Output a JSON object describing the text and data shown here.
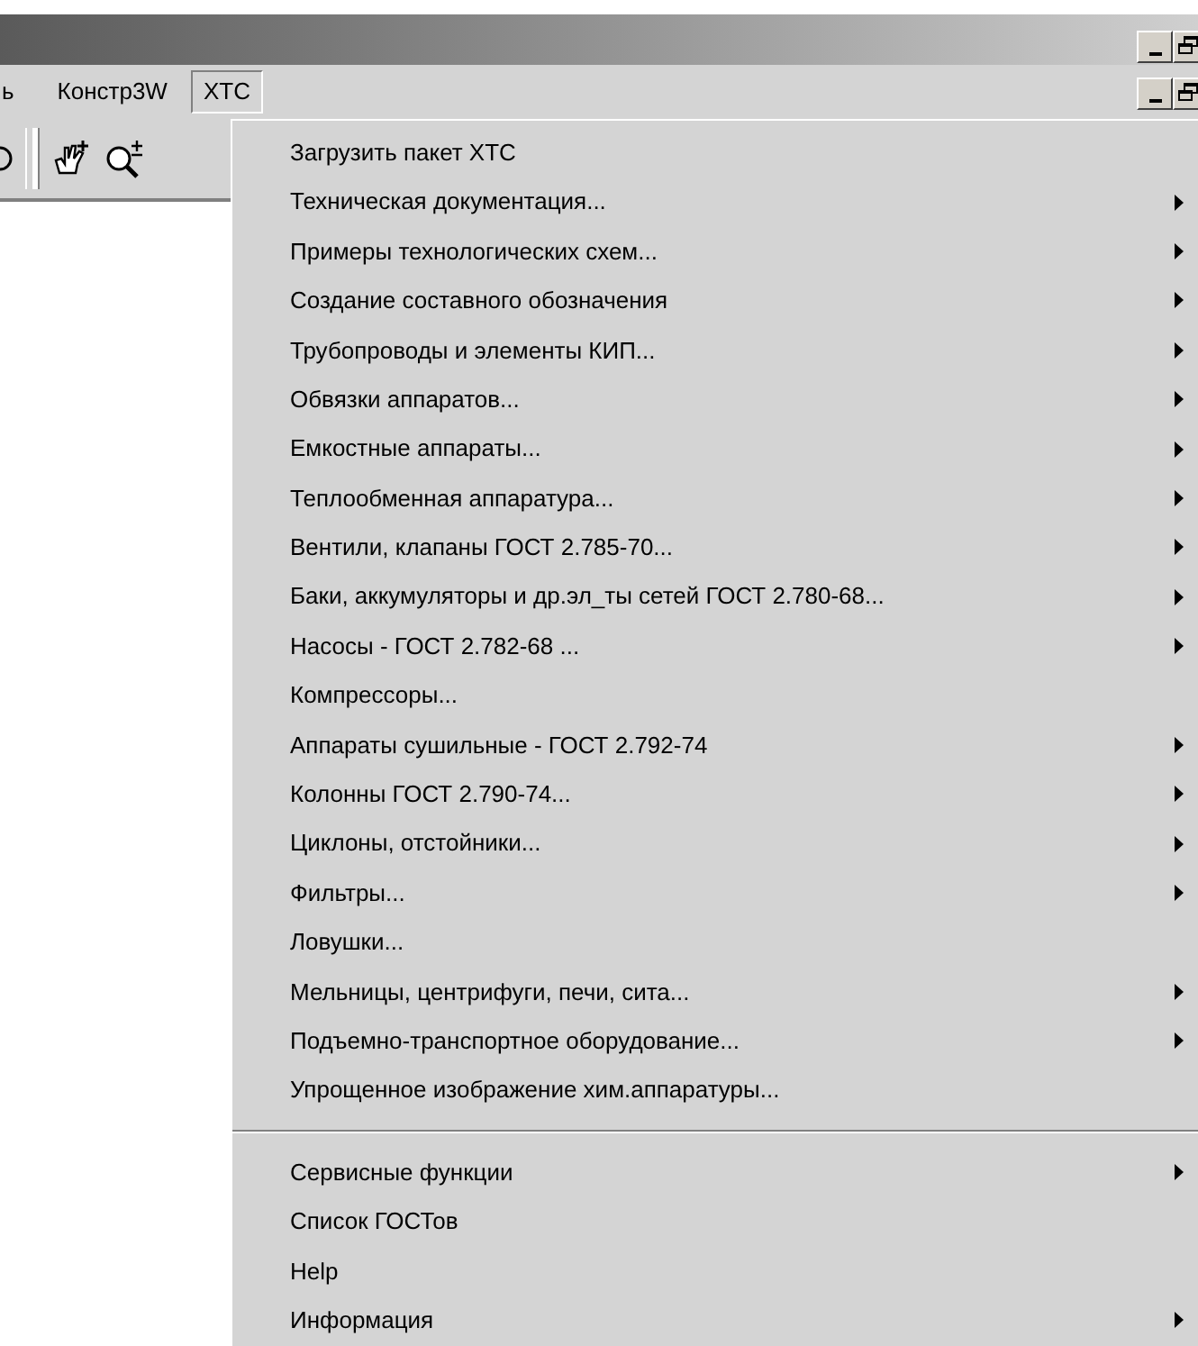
{
  "menubar": [
    {
      "label": "ь",
      "selected": false
    },
    {
      "label": "Констр3W",
      "selected": false
    },
    {
      "label": "XTC",
      "selected": true
    }
  ],
  "menu": {
    "items": [
      {
        "kind": "item",
        "label": "Загрузить пакет XTC",
        "submenu": false
      },
      {
        "kind": "item",
        "label": "Техническая документация...",
        "submenu": true
      },
      {
        "kind": "item",
        "label": "Примеры технологических схем...",
        "submenu": true
      },
      {
        "kind": "item",
        "label": "Создание составного обозначения",
        "submenu": true
      },
      {
        "kind": "item",
        "label": "Трубопроводы и элементы КИП...",
        "submenu": true
      },
      {
        "kind": "item",
        "label": "Обвязки аппаратов...",
        "submenu": true
      },
      {
        "kind": "item",
        "label": "Емкостные аппараты...",
        "submenu": true
      },
      {
        "kind": "item",
        "label": "Теплообменная аппаратура...",
        "submenu": true
      },
      {
        "kind": "item",
        "label": "Вентили, клапаны  ГОСТ 2.785-70...",
        "submenu": true
      },
      {
        "kind": "item",
        "label": "Баки, аккумуляторы и др.эл_ты сетей ГОСТ 2.780-68...",
        "submenu": true
      },
      {
        "kind": "item",
        "label": "Насосы - ГОСТ 2.782-68 ...",
        "submenu": true
      },
      {
        "kind": "item",
        "label": "Компрессоры...",
        "submenu": false
      },
      {
        "kind": "item",
        "label": "Аппараты сушильные - ГОСТ 2.792-74",
        "submenu": true
      },
      {
        "kind": "item",
        "label": "Колонны ГОСТ 2.790-74...",
        "submenu": true
      },
      {
        "kind": "item",
        "label": "Циклоны, отстойники...",
        "submenu": true
      },
      {
        "kind": "item",
        "label": "Фильтры...",
        "submenu": true
      },
      {
        "kind": "item",
        "label": "Ловушки...",
        "submenu": false
      },
      {
        "kind": "item",
        "label": "Мельницы, центрифуги, печи, сита...",
        "submenu": true
      },
      {
        "kind": "item",
        "label": "Подъемно-транспортное оборудование...",
        "submenu": true
      },
      {
        "kind": "item",
        "label": "Упрощенное изображение хим.аппаратуры...",
        "submenu": false
      },
      {
        "kind": "separator"
      },
      {
        "kind": "item",
        "label": "Сервисные функции",
        "submenu": true
      },
      {
        "kind": "item",
        "label": "Список ГОСТов",
        "submenu": false
      },
      {
        "kind": "item",
        "label": "Help",
        "submenu": false
      },
      {
        "kind": "item",
        "label": "Информация",
        "submenu": true
      }
    ]
  }
}
